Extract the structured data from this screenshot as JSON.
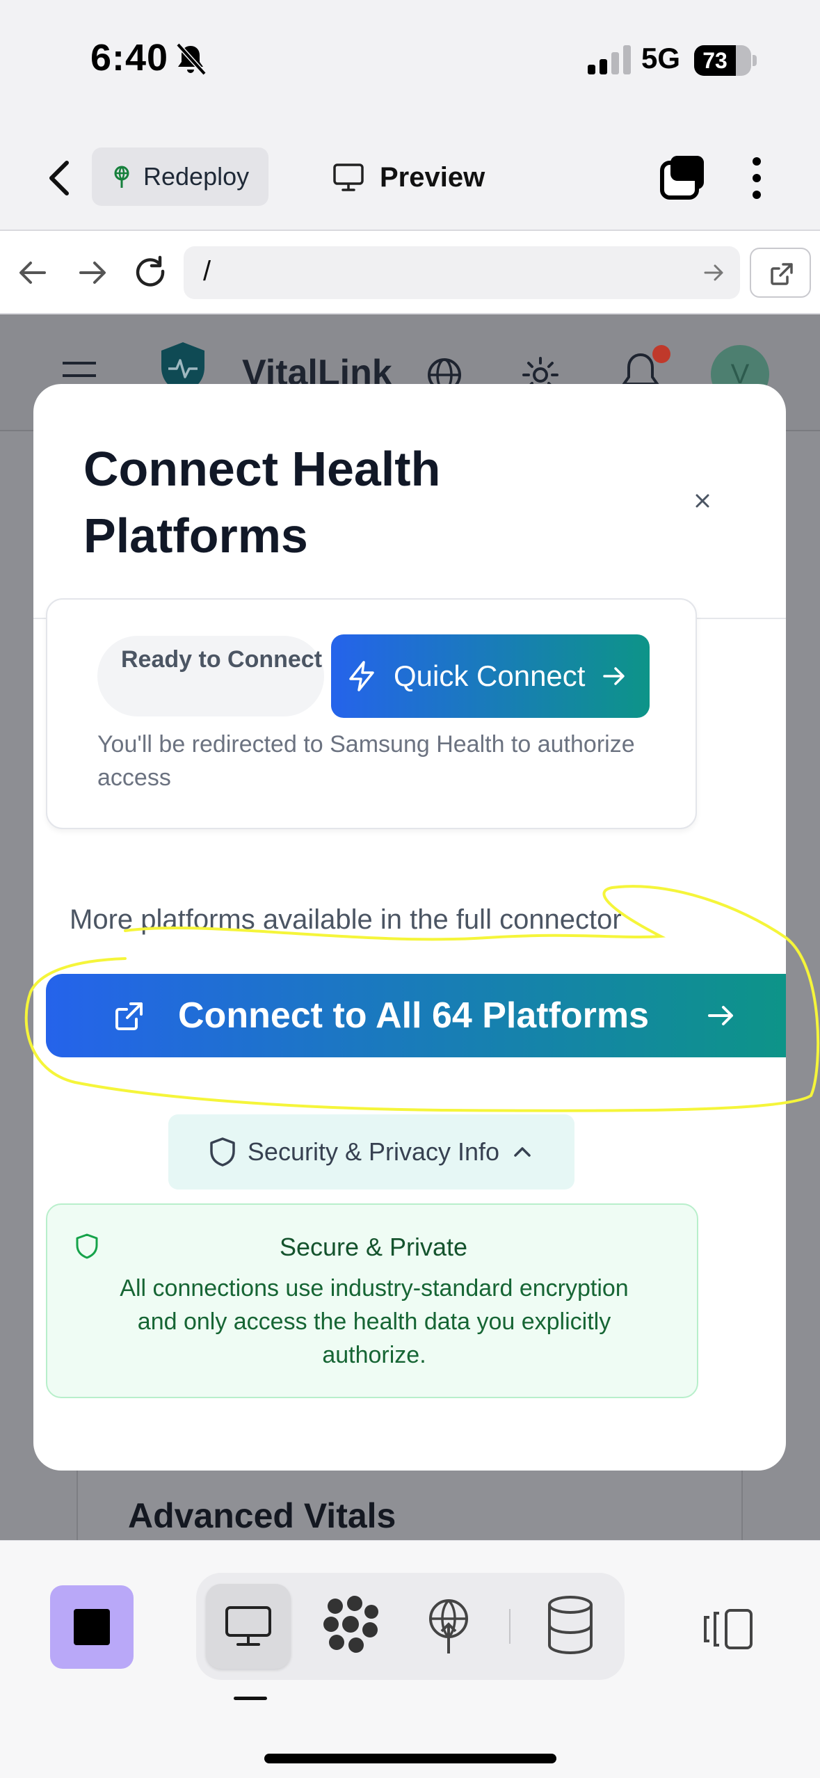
{
  "status_bar": {
    "time": "6:40",
    "network": "5G",
    "battery": "73",
    "battery_level": 0.73,
    "silent_icon": "bell-slash-icon"
  },
  "app_toolbar": {
    "redeploy_label": "Redeploy",
    "preview_label": "Preview"
  },
  "url_bar": {
    "url": "/"
  },
  "background_page": {
    "brand_name": "VitalLink",
    "avatar_initial": "V",
    "section_title": "Advanced Vitals"
  },
  "modal": {
    "title": "Connect Health Platforms",
    "close_symbol": "×",
    "platform_card": {
      "status": "Ready to Connect",
      "quick_connect_label": "Quick Connect",
      "redirect_note": "You'll be redirected to Samsung Health to authorize access"
    },
    "more_platforms_text": "More platforms available in the full connector",
    "connect_all_label": "Connect to All 64 Platforms",
    "security_toggle_label": "Security & Privacy Info",
    "secure_box": {
      "title": "Secure & Private",
      "description": "All connections use industry-standard encryption and only access the health data you explicitly authorize."
    }
  },
  "colors": {
    "gradient_start": "#2563eb",
    "gradient_end": "#0d9488",
    "annotation": "#f5f53a",
    "stop_button": "#b9a8f8",
    "secure_bg": "#effcf4"
  }
}
